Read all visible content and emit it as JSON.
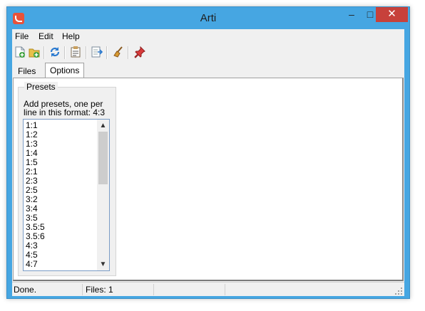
{
  "window": {
    "title": "Arti"
  },
  "window_controls": {
    "minimize": "–",
    "maximize": "□",
    "close": "✕"
  },
  "menu": {
    "items": [
      "File",
      "Edit",
      "Help"
    ]
  },
  "toolbar": {
    "buttons": [
      "new-file-icon",
      "add-folder-icon",
      "refresh-icon",
      "properties-icon",
      "export-icon",
      "clean-icon",
      "pin-icon"
    ]
  },
  "tabs": {
    "files": "Files",
    "options": "Options"
  },
  "options": {
    "group_label": "Presets",
    "help_text": "Add presets, one per line in this format: 4:3",
    "presets": "1:1\n1:2\n1:3\n1:4\n1:5\n2:1\n2:3\n2:5\n3:2\n3:4\n3:5\n3.5:5\n3.5:6\n4:3\n4:5\n4:7"
  },
  "status": {
    "message": "Done.",
    "files": "Files: 1"
  },
  "colors": {
    "titlebar": "#46a6e2",
    "close": "#c7413b",
    "app_icon": "#e8523a"
  }
}
